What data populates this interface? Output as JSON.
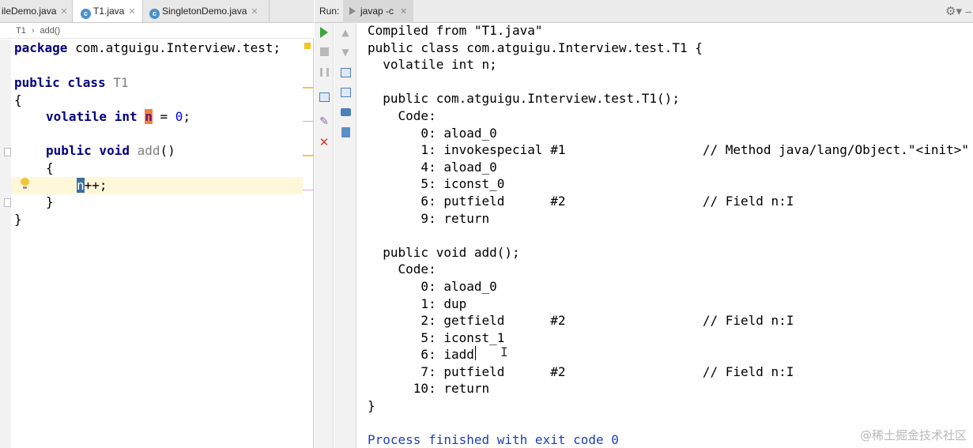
{
  "editor": {
    "tabs": [
      {
        "label": "ileDemo.java",
        "active": false
      },
      {
        "label": "T1.java",
        "active": true
      },
      {
        "label": "SingletonDemo.java",
        "active": false
      }
    ],
    "breadcrumb": [
      "T1",
      "add()"
    ],
    "code": {
      "line1_kw": "package",
      "line1_rest": " com.atguigu.Interview.test;",
      "line2_kw": "public class",
      "line2_cls": " T1",
      "line3": "{",
      "line4_kw1": "volatile",
      "line4_kw2": "int",
      "line4_var": "n",
      "line4_eq": " = ",
      "line4_num": "0",
      "line4_end": ";",
      "line5_kw": "public void",
      "line5_meth": " add",
      "line5_paren": "()",
      "line6": "{",
      "line7_var": "n",
      "line7_rest": "++;",
      "line8": "}",
      "line9": "}"
    }
  },
  "run": {
    "label": "Run:",
    "tab_label": "javap -c",
    "output_lines": [
      "Compiled from \"T1.java\"",
      "public class com.atguigu.Interview.test.T1 {",
      "  volatile int n;",
      "",
      "  public com.atguigu.Interview.test.T1();",
      "    Code:",
      "       0: aload_0",
      "       1: invokespecial #1                  // Method java/lang/Object.\"<init>\"",
      "       4: aload_0",
      "       5: iconst_0",
      "       6: putfield      #2                  // Field n:I",
      "       9: return",
      "",
      "  public void add();",
      "    Code:",
      "       0: aload_0",
      "       1: dup",
      "       2: getfield      #2                  // Field n:I",
      "       5: iconst_1",
      "       6: iadd",
      "       7: putfield      #2                  // Field n:I",
      "      10: return",
      "}",
      ""
    ],
    "exit_line": "Process finished with exit code 0"
  },
  "watermark": "@稀土掘金技术社区",
  "icons": {
    "run": "run-icon",
    "stop": "stop-icon",
    "pause": "pause-icon",
    "settings": "gear-icon"
  }
}
